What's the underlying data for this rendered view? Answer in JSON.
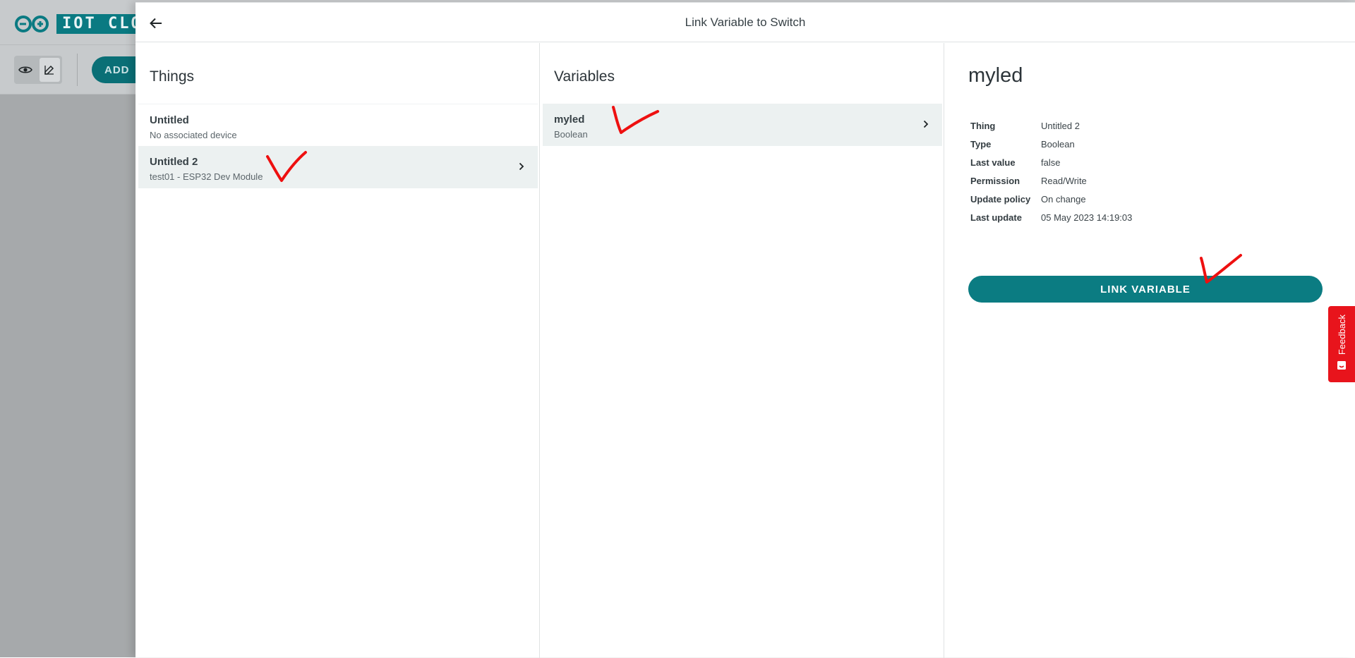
{
  "background": {
    "brand_text": "IOT CLOU",
    "add_button_label": "ADD"
  },
  "panel": {
    "title": "Link Variable to Switch"
  },
  "things": {
    "heading": "Things",
    "items": [
      {
        "title": "Untitled",
        "subtitle": "No associated device"
      },
      {
        "title": "Untitled 2",
        "subtitle": "test01 - ESP32 Dev Module"
      }
    ]
  },
  "variables": {
    "heading": "Variables",
    "items": [
      {
        "title": "myled",
        "subtitle": "Boolean"
      }
    ]
  },
  "detail": {
    "name": "myled",
    "properties": [
      {
        "key": "Thing",
        "value": "Untitled 2"
      },
      {
        "key": "Type",
        "value": "Boolean"
      },
      {
        "key": "Last value",
        "value": "false"
      },
      {
        "key": "Permission",
        "value": "Read/Write"
      },
      {
        "key": "Update policy",
        "value": "On change"
      },
      {
        "key": "Last update",
        "value": "05 May 2023 14:19:03"
      }
    ],
    "link_button_label": "LINK VARIABLE"
  },
  "feedback": {
    "label": "Feedback"
  },
  "colors": {
    "accent": "#0b7c82",
    "feedback": "#e8141c",
    "annotation": "#ee1010"
  }
}
